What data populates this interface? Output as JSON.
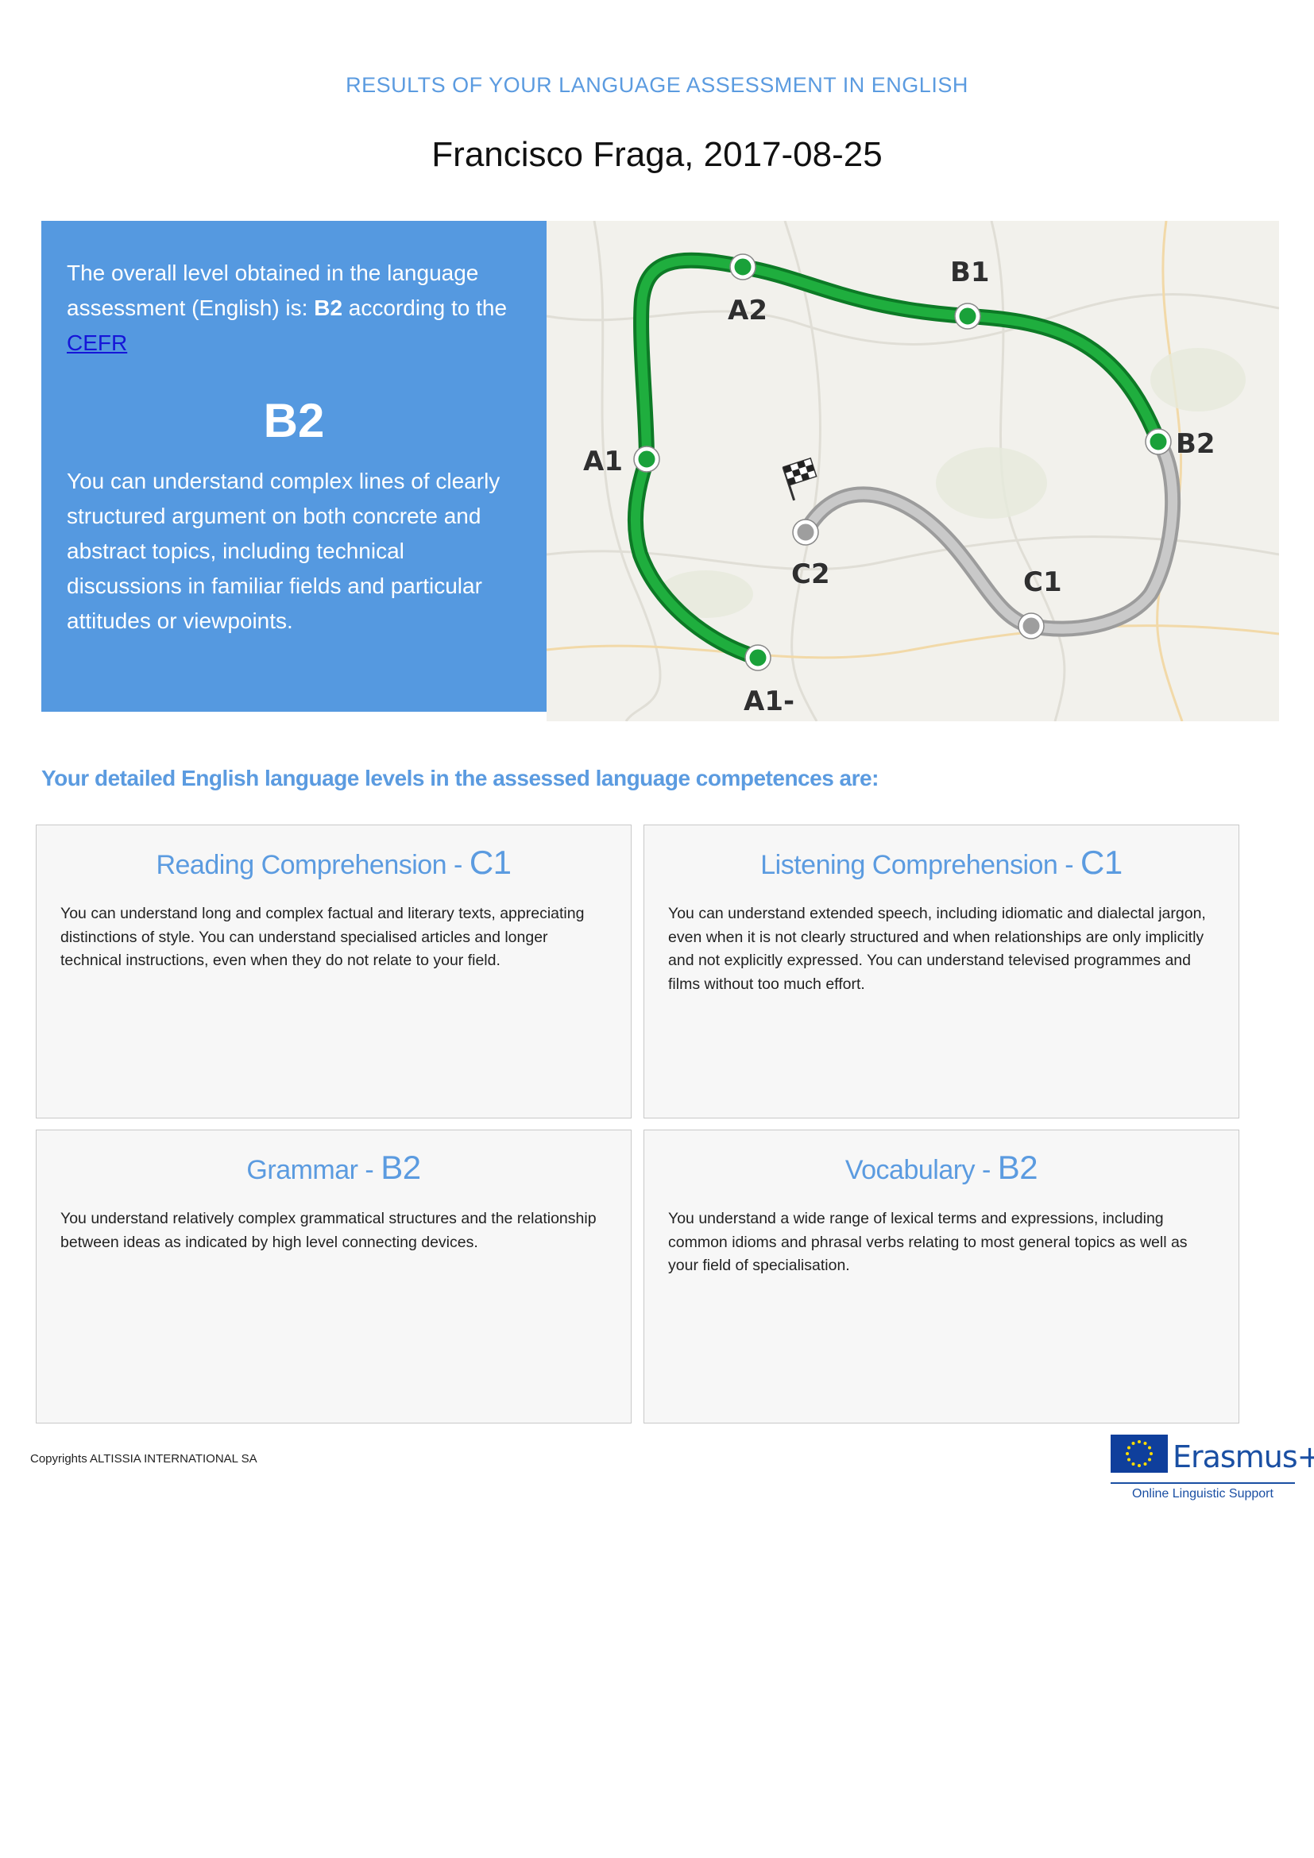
{
  "header": {
    "subtitle": "RESULTS OF YOUR LANGUAGE ASSESSMENT IN ENGLISH",
    "name_date": "Francisco Fraga, 2017-08-25"
  },
  "summary": {
    "intro_before": "The overall level obtained in the language assessment (English) is: ",
    "intro_level": "B2",
    "intro_after": " according to the ",
    "cefr_link": "CEFR",
    "level": "B2",
    "description": "You can understand complex lines of clearly structured argument on both concrete and abstract topics, including technical discussions in familiar fields and particular attitudes or viewpoints."
  },
  "level_map": {
    "achieved_color": "#1aa13a",
    "remaining_color": "#b5b5b5",
    "levels": [
      {
        "label": "A1-",
        "achieved": true
      },
      {
        "label": "A1",
        "achieved": true
      },
      {
        "label": "A2",
        "achieved": true
      },
      {
        "label": "B1",
        "achieved": true
      },
      {
        "label": "B2",
        "achieved": true
      },
      {
        "label": "C1",
        "achieved": false
      },
      {
        "label": "C2",
        "achieved": false
      }
    ],
    "finish_icon": "checkered-flag-icon"
  },
  "details_heading": "Your detailed English language levels in the assessed language competences are:",
  "competences": [
    {
      "name": "Reading Comprehension - ",
      "level": "C1",
      "description": "You can understand long and complex factual and literary texts, appreciating distinctions of style. You can understand specialised articles and longer technical instructions, even when they do not relate to your field."
    },
    {
      "name": "Listening Comprehension - ",
      "level": "C1",
      "description": "You can understand extended speech, including idiomatic and dialectal jargon, even when it is not clearly structured and when relationships are only implicitly and not explicitly expressed. You can understand televised programmes and films without too much effort."
    },
    {
      "name": "Grammar - ",
      "level": "B2",
      "description": "You understand relatively complex grammatical structures and the relationship between ideas as indicated by high level connecting devices."
    },
    {
      "name": "Vocabulary - ",
      "level": "B2",
      "description": "You understand a wide range of lexical terms and expressions, including common idioms and phrasal verbs relating to most general topics as well as your field of specialisation."
    }
  ],
  "footer": {
    "copyright": "Copyrights ALTISSIA INTERNATIONAL SA",
    "logo_brand": "Erasmus+",
    "logo_tagline": "Online Linguistic Support"
  }
}
